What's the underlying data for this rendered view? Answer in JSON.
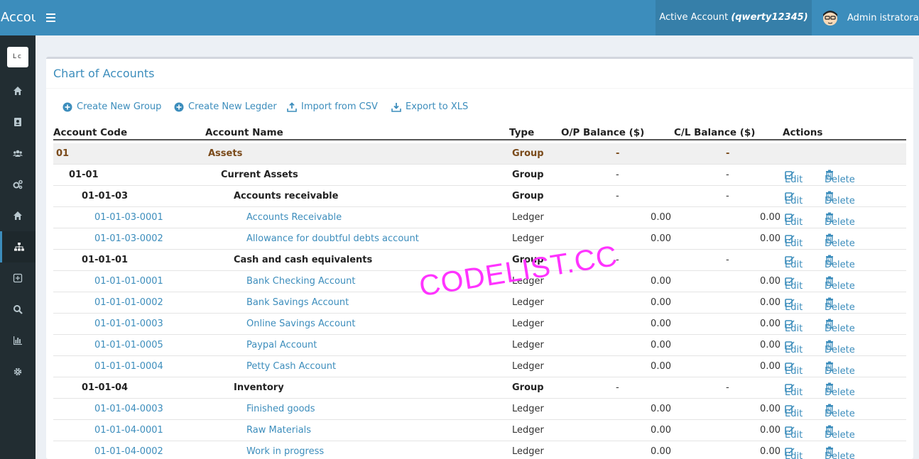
{
  "header": {
    "brand": "Accounting",
    "active_account_label": "Active Account",
    "active_account_name": "(qwerty12345)",
    "user_name": "Admin istratora"
  },
  "sidebar": {
    "logo_text": "Lc",
    "items": [
      {
        "icon": "home-icon"
      },
      {
        "icon": "address-book-icon"
      },
      {
        "icon": "users-icon"
      },
      {
        "icon": "gears-icon"
      },
      {
        "icon": "home-icon"
      },
      {
        "icon": "sitemap-icon",
        "active": true
      },
      {
        "icon": "plus-square-icon"
      },
      {
        "icon": "search-icon"
      },
      {
        "icon": "bar-chart-icon"
      },
      {
        "icon": "gear-icon"
      }
    ]
  },
  "page": {
    "title": "Chart of Accounts",
    "toolbar": {
      "create_group": "Create New Group",
      "create_ledger": "Create New Legder",
      "import_csv": "Import from CSV",
      "export_xls": "Export to XLS"
    }
  },
  "table": {
    "headers": {
      "code": "Account Code",
      "name": "Account Name",
      "type": "Type",
      "op": "O/P Balance ($)",
      "cl": "C/L Balance ($)",
      "actions": "Actions"
    },
    "edit_label": "Edit",
    "delete_label": "Delete",
    "rows": [
      {
        "code": "01",
        "name": "Assets",
        "type": "Group",
        "op": "-",
        "cl": "-"
      },
      {
        "code": "01-01",
        "name": "Current Assets",
        "type": "Group",
        "op": "-",
        "cl": "-"
      },
      {
        "code": "01-01-03",
        "name": "Accounts receivable",
        "type": "Group",
        "op": "-",
        "cl": "-"
      },
      {
        "code": "01-01-03-0001",
        "name": "Accounts Receivable",
        "type": "Ledger",
        "op": "0.00",
        "cl": "0.00"
      },
      {
        "code": "01-01-03-0002",
        "name": "Allowance for doubtful debts account",
        "type": "Ledger",
        "op": "0.00",
        "cl": "0.00"
      },
      {
        "code": "01-01-01",
        "name": "Cash and cash equivalents",
        "type": "Group",
        "op": "-",
        "cl": "-"
      },
      {
        "code": "01-01-01-0001",
        "name": "Bank Checking Account",
        "type": "Ledger",
        "op": "0.00",
        "cl": "0.00"
      },
      {
        "code": "01-01-01-0002",
        "name": "Bank Savings Account",
        "type": "Ledger",
        "op": "0.00",
        "cl": "0.00"
      },
      {
        "code": "01-01-01-0003",
        "name": "Online Savings Account",
        "type": "Ledger",
        "op": "0.00",
        "cl": "0.00"
      },
      {
        "code": "01-01-01-0005",
        "name": "Paypal Account",
        "type": "Ledger",
        "op": "0.00",
        "cl": "0.00"
      },
      {
        "code": "01-01-01-0004",
        "name": "Petty Cash Account",
        "type": "Ledger",
        "op": "0.00",
        "cl": "0.00"
      },
      {
        "code": "01-01-04",
        "name": "Inventory",
        "type": "Group",
        "op": "-",
        "cl": "-"
      },
      {
        "code": "01-01-04-0003",
        "name": "Finished goods",
        "type": "Ledger",
        "op": "0.00",
        "cl": "0.00"
      },
      {
        "code": "01-01-04-0001",
        "name": "Raw Materials",
        "type": "Ledger",
        "op": "0.00",
        "cl": "0.00"
      },
      {
        "code": "01-01-04-0002",
        "name": "Work in progress",
        "type": "Ledger",
        "op": "0.00",
        "cl": "0.00"
      }
    ]
  },
  "watermark": "CODELIST.CC",
  "colors": {
    "header": "#3c8dbc",
    "sidebar": "#222d32",
    "link": "#3c8dbc",
    "top_group": "#7a4a1a",
    "watermark": "#ff33ff"
  }
}
